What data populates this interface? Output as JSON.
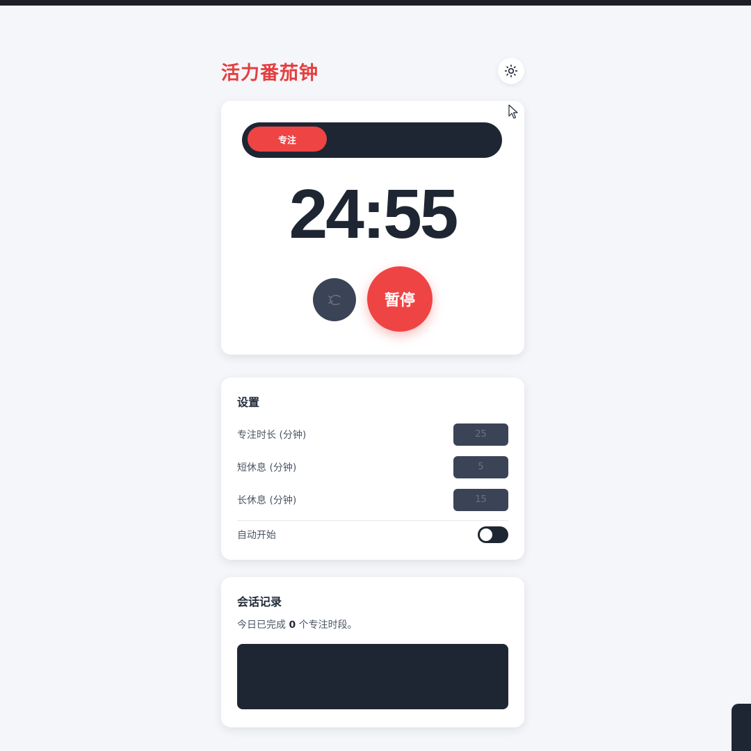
{
  "app": {
    "title": "活力番茄钟",
    "theme_toggle_icon": "sun-icon"
  },
  "timer": {
    "mode_label": "专注",
    "time": "24:55",
    "reset_icon": "reset-icon",
    "pause_label": "暂停"
  },
  "settings": {
    "title": "设置",
    "focus_label": "专注时长 (分钟)",
    "focus_value": "25",
    "short_break_label": "短休息 (分钟)",
    "short_break_value": "5",
    "long_break_label": "长休息 (分钟)",
    "long_break_value": "15",
    "auto_start_label": "自动开始",
    "auto_start_on": false
  },
  "history": {
    "title": "会话记录",
    "summary_prefix": "今日已完成 ",
    "completed_count": "0",
    "summary_suffix": " 个专注时段。"
  },
  "colors": {
    "accent": "#ef4444",
    "title": "#e53e3e",
    "dark": "#1f2633",
    "background": "#f5f6fa"
  }
}
